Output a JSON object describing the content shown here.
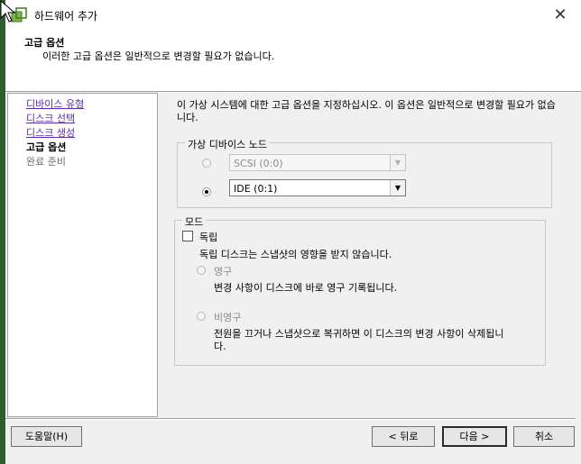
{
  "window": {
    "title": "하드웨어 추가"
  },
  "header": {
    "title": "고급 옵션",
    "subtitle": "이러한 고급 옵션은 일반적으로 변경할 필요가 없습니다."
  },
  "steps": [
    {
      "label": "디바이스 유형",
      "state": "link"
    },
    {
      "label": "디스크 선택",
      "state": "link"
    },
    {
      "label": "디스크 생성",
      "state": "link"
    },
    {
      "label": "고급 옵션",
      "state": "current"
    },
    {
      "label": "완료 준비",
      "state": "future"
    }
  ],
  "main": {
    "description": "이 가상 시스템에 대한 고급 옵션을 지정하십시오. 이 옵션은 일반적으로 변경할 필요가 없습니다.",
    "node_group": {
      "label": "가상 디바이스 노드",
      "scsi_value": "SCSI (0:0)",
      "ide_value": "IDE (0:1)",
      "selected": "ide"
    },
    "mode_group": {
      "label": "모드",
      "independent_label": "독립",
      "independent_desc": "독립 디스크는 스냅샷의 영향을 받지 않습니다.",
      "persistent_label": "영구",
      "persistent_desc": "변경 사항이 디스크에 바로 영구 기록됩니다.",
      "nonpersistent_label": "비영구",
      "nonpersistent_desc_1": "전원을 끄거나 스냅샷으로 복귀하면 이 디스크의 변경 사항이 삭제됩니",
      "nonpersistent_desc_2": "다."
    }
  },
  "footer": {
    "help": "도움말(H)",
    "back": "< 뒤로",
    "next": "다음 >",
    "cancel": "취소"
  },
  "colors": {
    "link": "#5a2ea8",
    "disabled": "#8a8a8a",
    "dialog_bg": "#f0f0f0"
  }
}
